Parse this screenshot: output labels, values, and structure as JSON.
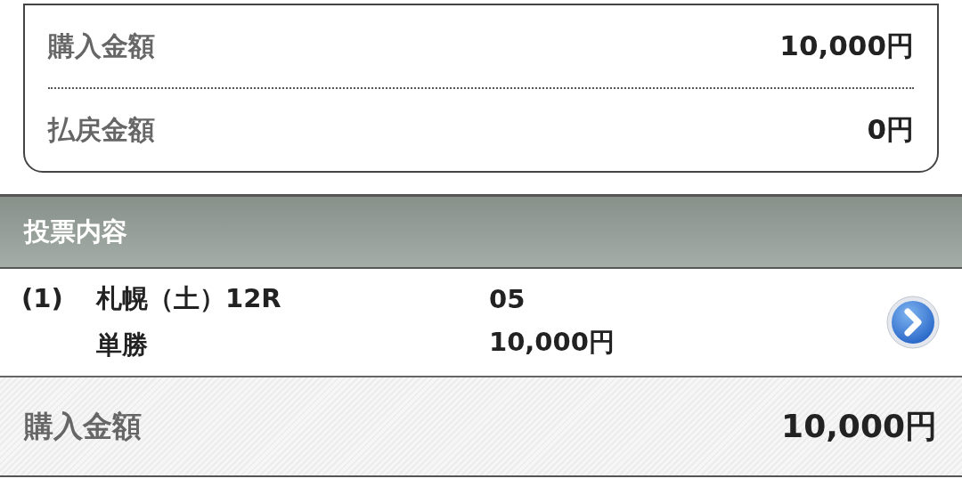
{
  "summary": {
    "rows": [
      {
        "label": "購入金額",
        "value": "10,000円"
      },
      {
        "label": "払戻金額",
        "value": "0円"
      }
    ]
  },
  "section": {
    "title": "投票内容"
  },
  "bets": [
    {
      "number": "(1)",
      "race": "札幌（土）12R",
      "bet_type": "単勝",
      "horse": "05",
      "amount": "10,000円"
    }
  ],
  "total": {
    "label": "購入金額",
    "value": "10,000円"
  }
}
